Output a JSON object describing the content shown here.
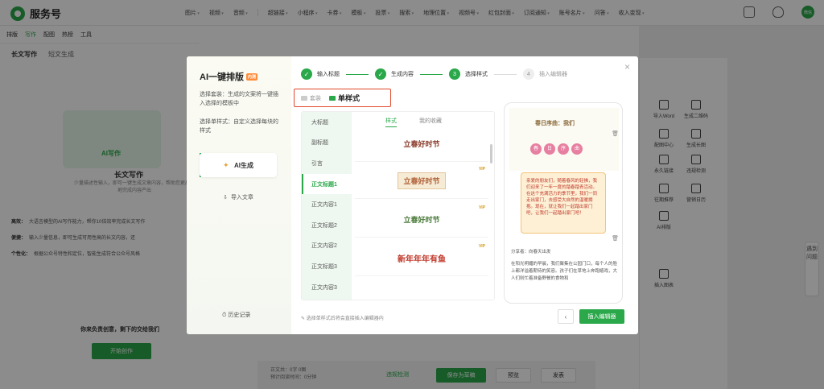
{
  "app": {
    "name": "服务号"
  },
  "topnav": [
    "图片",
    "视频",
    "音频",
    "超链接",
    "小程序",
    "卡券",
    "模板",
    "投票",
    "搜索",
    "地理位置",
    "视频号",
    "红包封面",
    "订阅通知",
    "账号名片",
    "问答",
    "收入变现"
  ],
  "avatar": "微信",
  "left": {
    "toolbar": [
      "排版",
      "写作",
      "配图",
      "热榜",
      "工具"
    ],
    "tabs": [
      "长文写作",
      "短文生成"
    ],
    "hero_label": "AI写作",
    "title": "长文写作",
    "desc": "少量描述性输入，即可一键生成文章内容，帮助您更高效地完成内容产出",
    "features": [
      {
        "k": "高效：",
        "v": "大语言模型的AI写作能力，帮你10倍效率完成长文写作"
      },
      {
        "k": "便捷：",
        "v": "输入少量信息，即可生成可用性高的长文内容，还"
      },
      {
        "k": "个性化：",
        "v": "根据公众号特性和定位，智能生成符合公众号风格"
      }
    ],
    "slogan": "你来负责创意，剩下的交给我们",
    "start": "开始创作"
  },
  "right_tools": [
    "导入Word",
    "生成二维码",
    "配图中心",
    "生成长图",
    "永久链接",
    "违规检测",
    "往期推荐",
    "营销日历",
    "AI排版",
    "",
    "插入图表",
    ""
  ],
  "feedback": "遇到问题",
  "bottom": {
    "stats1": "正文共：0字 0图",
    "stats2": "预计阅读时间：0分钟",
    "check": "违规检测",
    "save": "保存为草稿",
    "preview": "预览",
    "publish": "发表"
  },
  "modal": {
    "title": "AI一键排版",
    "badge": "内测",
    "desc1": "选择套装：生成的文案将一键插入选择的模板中",
    "desc2": "选择单样式：自定义选择每块的样式",
    "ai_btn": "AI生成",
    "import_btn": "导入文章",
    "history": "历史记录",
    "steps": [
      {
        "label": "输入标题",
        "state": "done"
      },
      {
        "label": "生成内容",
        "state": "done"
      },
      {
        "label": "选择样式",
        "state": "active",
        "num": "3"
      },
      {
        "label": "插入编辑器",
        "state": "todo",
        "num": "4"
      }
    ],
    "tab_set": "套装",
    "tab_single": "单样式",
    "categories": [
      "大标题",
      "副标题",
      "引言",
      "正文标题1",
      "正文内容1",
      "正文标题2",
      "正文内容2",
      "正文标题3",
      "正文内容3"
    ],
    "inner_tabs": [
      "样式",
      "我的收藏"
    ],
    "templates": [
      "立春好时节",
      "立春好时节",
      "立春好时节",
      "新年年年有鱼"
    ],
    "vip": "VIP",
    "preview": {
      "head": "春日序曲：我们",
      "flower_chars": [
        "春",
        "日",
        "序",
        "曲"
      ],
      "note": "亲爱的朋友们，随着春风的轻拂，我们迎来了一年一度的踏春踏青活动。在这个充满活力的季节里，我们一同走出家门，去感受大自然的温暖拥抱。现在，就让我们一起踏出家门吧，让我们一起踏出家门吧！",
      "author": "分享者：向春天出发",
      "body": "在阳光明媚的早晨，我们聚集在公园门口，每个人的脸上都洋溢着期待的笑容。孩子们在草地上奔跑嬉戏，大人们则忙着准备野餐的食物和"
    },
    "tip": "选择单样式后将会直接插入编辑器内",
    "prev": "‹",
    "insert": "插入编辑器",
    "close": "×"
  }
}
